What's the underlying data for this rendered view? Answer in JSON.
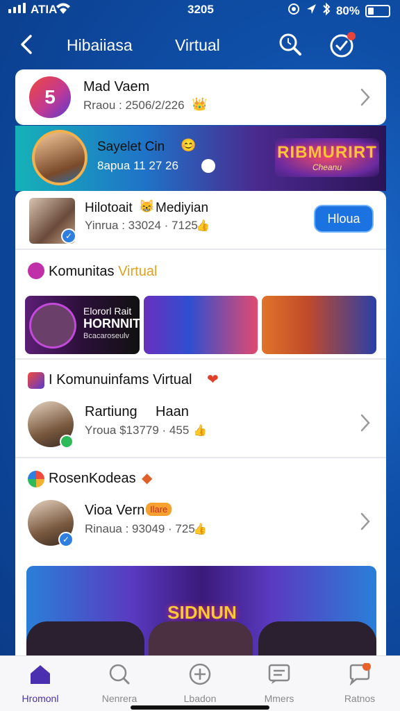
{
  "status_bar": {
    "carrier": "ATIA",
    "time": "3205",
    "battery": "80%"
  },
  "header": {
    "title_left": "Hibaiiasa",
    "title_right": "Virtual"
  },
  "profile_card": {
    "avatar_text": "5",
    "name": "Mad Vaem",
    "subtitle": "Rraou : 2506/2/226"
  },
  "banner": {
    "name": "Sayelet Cin",
    "subtitle": "8apua 11 27 26",
    "sign_main": "RIBMURIRT",
    "sign_sub": "Cheanu"
  },
  "featured_user": {
    "name": "Hilotoait",
    "name_extra": "Mediyian",
    "subtitle": "Yinrua : 33024 · 7125",
    "button_label": "Hloua"
  },
  "section_community": {
    "title_prefix": "Komunitas",
    "title_accent": "Virtual",
    "tile1_line1": "Elororl Rait",
    "tile1_line2": "HORNNIT",
    "tile1_line3": "Bcacaroseulv"
  },
  "section_komunitifams": {
    "title": "I Komunuinfams Virtual",
    "row_name": "Rartiung",
    "row_name_extra": "Haan",
    "row_subtitle": "Yroua $13779 · 455"
  },
  "section_rosen": {
    "title": "RosenKodeas",
    "row_name": "Vioa Vern",
    "row_badge": "Ilare",
    "row_subtitle": "Rinaua : 93049 · 725"
  },
  "promo": {
    "text": "SIDNUN"
  },
  "bottom_nav": {
    "items": [
      {
        "label": "Hromonl"
      },
      {
        "label": "Nenrera"
      },
      {
        "label": "Lbadon"
      },
      {
        "label": "Mmers"
      },
      {
        "label": "Ratnos"
      }
    ]
  },
  "colors": {
    "brand_blue": "#1a73e0",
    "background": "#0f4fa8",
    "accent_gold": "#e0a020",
    "nav_active": "#4a2fb0"
  }
}
